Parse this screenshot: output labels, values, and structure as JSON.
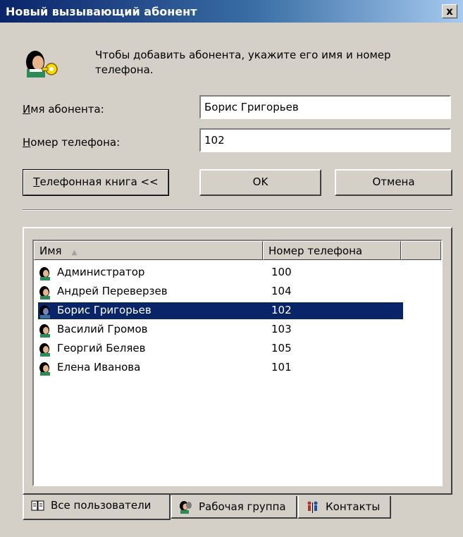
{
  "window": {
    "title": "Новый вызывающий абонент",
    "close_label": "x"
  },
  "intro": {
    "line1": "Чтобы добавить абонента, укажите его имя и номер",
    "line2": "телефона."
  },
  "form": {
    "name_label_mnemonic": "И",
    "name_label_rest": "мя абонента:",
    "name_value": "Борис Григорьев",
    "phone_label_mnemonic": "Н",
    "phone_label_rest": "омер телефона:",
    "phone_value": "102"
  },
  "buttons": {
    "phonebook_mnemonic": "Т",
    "phonebook_rest": "елефонная книга <<",
    "ok": "OK",
    "cancel": "Отмена"
  },
  "list": {
    "columns": {
      "name": "Имя",
      "phone": "Номер телефона"
    },
    "sort_indicator": "▲",
    "rows": [
      {
        "name": "Администратор",
        "phone": "100",
        "selected": false
      },
      {
        "name": "Андрей Переверзев",
        "phone": "104",
        "selected": false
      },
      {
        "name": "Борис Григорьев",
        "phone": "102",
        "selected": true
      },
      {
        "name": "Василий Громов",
        "phone": "103",
        "selected": false
      },
      {
        "name": "Георгий Беляев",
        "phone": "105",
        "selected": false
      },
      {
        "name": "Елена Иванова",
        "phone": "101",
        "selected": false
      }
    ]
  },
  "tabs": [
    {
      "label": "Все пользователи",
      "icon": "book-icon",
      "active": true
    },
    {
      "label": "Рабочая группа",
      "icon": "workgroup-icon",
      "active": false
    },
    {
      "label": "Контакты",
      "icon": "contacts-icon",
      "active": false
    }
  ],
  "colors": {
    "selection": "#0a246a",
    "title_bar": "#0a246a",
    "face": "#d4d0c8"
  }
}
